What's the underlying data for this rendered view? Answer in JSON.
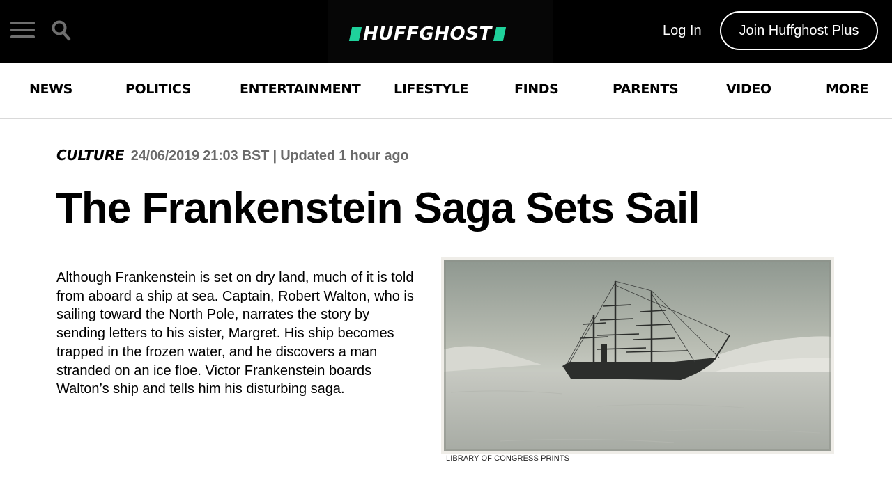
{
  "header": {
    "logo_text": "HUFFGHOST",
    "login_label": "Log In",
    "join_label": "Join Huffghost Plus",
    "menu_icon": "hamburger-menu-icon",
    "search_icon": "search-icon",
    "accent_color": "#1fd19b"
  },
  "nav": {
    "items": [
      "NEWS",
      "POLITICS",
      "ENTERTAINMENT",
      "LIFESTYLE",
      "FINDS",
      "PARENTS",
      "VIDEO",
      "MORE"
    ]
  },
  "article": {
    "category": "CULTURE",
    "timestamp": "24/06/2019 21:03 BST | Updated 1 hour ago",
    "title": "The Frankenstein Saga Sets Sail",
    "body": "Although Frankenstein is set on dry land, much of it is told from aboard a ship at sea. Captain, Robert Walton, who is sailing toward the North Pole, narrates the story by sending letters to his sister, Margret. His ship becomes trapped in the frozen water, and he discovers a man stranded on an ice floe. Victor Frankenstein boards Walton’s ship and tells him his disturbing saga.",
    "image_credit": "LIBRARY OF CONGRESS PRINTS"
  }
}
